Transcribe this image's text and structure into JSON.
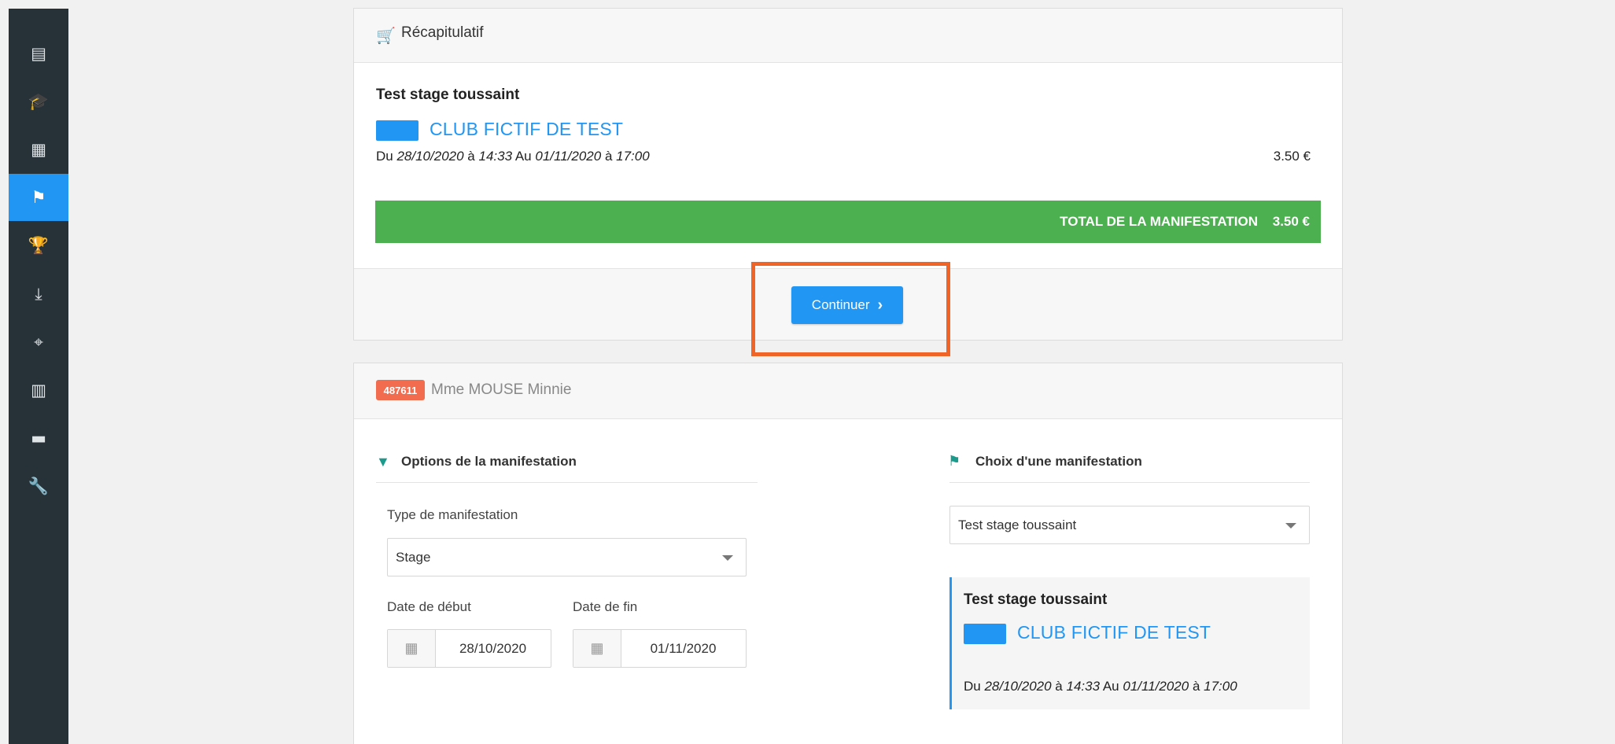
{
  "colors": {
    "sidebar_bg": "#273238",
    "accent": "#2196f3",
    "total_bar": "#4caf50",
    "highlight": "#f06427",
    "badge": "#f26c4f",
    "section_icon": "#1c9b8c"
  },
  "sidebar": {
    "items": [
      {
        "icon": "newspaper-icon",
        "glyph": "▤",
        "active": false
      },
      {
        "icon": "graduation-cap-icon",
        "glyph": "🎓",
        "active": false
      },
      {
        "icon": "calendar-icon",
        "glyph": "▦",
        "active": false
      },
      {
        "icon": "checkered-flag-icon",
        "glyph": "⚑",
        "active": true
      },
      {
        "icon": "trophy-icon",
        "glyph": "🏆",
        "active": false
      },
      {
        "icon": "inbox-download-icon",
        "glyph": "⤓",
        "active": false
      },
      {
        "icon": "map-marker-icon",
        "glyph": "⌖",
        "active": false
      },
      {
        "icon": "bar-chart-icon",
        "glyph": "▥",
        "active": false
      },
      {
        "icon": "folder-icon",
        "glyph": "▬",
        "active": false
      },
      {
        "icon": "wrench-icon",
        "glyph": "🔧",
        "active": false
      }
    ]
  },
  "recap": {
    "title": "Récapitulatif",
    "event_name": "Test stage toussaint",
    "club_name": "CLUB FICTIF DE TEST",
    "dates": {
      "du": "Du",
      "start_date": "28/10/2020",
      "a1": "à",
      "start_time": "14:33",
      "au": "Au",
      "end_date": "01/11/2020",
      "a2": "à",
      "end_time": "17:00"
    },
    "price": "3.50 €",
    "total_label": "TOTAL DE LA MANIFESTATION",
    "total_value": "3.50 €",
    "continue_label": "Continuer",
    "continue_chevron": "›"
  },
  "participant": {
    "badge": "487611",
    "name": "Mme MOUSE Minnie"
  },
  "options": {
    "title": "Options de la manifestation",
    "type_label": "Type de manifestation",
    "type_value": "Stage",
    "start_label": "Date de début",
    "start_value": "28/10/2020",
    "end_label": "Date de fin",
    "end_value": "01/11/2020"
  },
  "choice": {
    "title": "Choix d'une manifestation",
    "select_value": "Test stage toussaint",
    "card": {
      "event_name": "Test stage toussaint",
      "club_name": "CLUB FICTIF DE TEST",
      "dates": {
        "du": "Du",
        "start_date": "28/10/2020",
        "a1": "à",
        "start_time": "14:33",
        "au": "Au",
        "end_date": "01/11/2020",
        "a2": "à",
        "end_time": "17:00"
      }
    }
  }
}
